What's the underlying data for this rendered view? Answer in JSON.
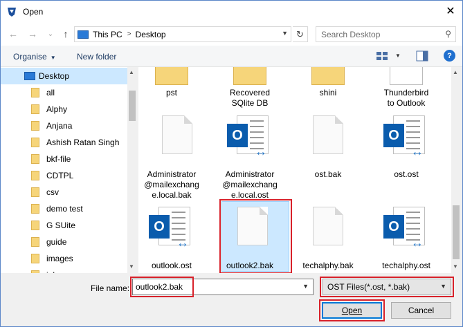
{
  "window": {
    "title": "Open",
    "close_glyph": "✕",
    "app_icon": "app-icon"
  },
  "nav": {
    "back": "←",
    "forward": "→",
    "recent": "⌄",
    "up": "↑",
    "breadcrumb": [
      "This PC",
      "Desktop"
    ],
    "search_placeholder": "Search Desktop"
  },
  "toolbar": {
    "organise": "Organise",
    "new_folder": "New folder",
    "help": "?"
  },
  "sidebar": {
    "items": [
      {
        "label": "Desktop",
        "selected": true,
        "icon": "desktop-icon"
      },
      {
        "label": "all"
      },
      {
        "label": "Alphy"
      },
      {
        "label": "Anjana"
      },
      {
        "label": "Ashish Ratan Singh"
      },
      {
        "label": "bkf-file"
      },
      {
        "label": "CDTPL"
      },
      {
        "label": "csv"
      },
      {
        "label": "demo test"
      },
      {
        "label": "G SUite"
      },
      {
        "label": "guide"
      },
      {
        "label": "images"
      },
      {
        "label": "jobs"
      }
    ]
  },
  "files": [
    {
      "lines": [
        "pst"
      ],
      "icon": "folder-icon"
    },
    {
      "lines": [
        "Recovered",
        "SQlite DB"
      ],
      "icon": "folder-icon"
    },
    {
      "lines": [
        "shini"
      ],
      "icon": "folder-icon"
    },
    {
      "lines": [
        "Thunderbird",
        "to Outlook"
      ],
      "icon": "folder-icon"
    },
    {
      "lines": [
        "Administrator",
        "@mailexchang",
        "e.local.bak"
      ],
      "icon": "document-icon"
    },
    {
      "lines": [
        "Administrator",
        "@mailexchang",
        "e.local.ost"
      ],
      "icon": "outlook-ost-icon"
    },
    {
      "lines": [
        "ost.bak"
      ],
      "icon": "document-icon"
    },
    {
      "lines": [
        "ost.ost"
      ],
      "icon": "outlook-ost-icon"
    },
    {
      "lines": [
        "outlook.ost"
      ],
      "icon": "outlook-ost-icon"
    },
    {
      "lines": [
        "outlook2.bak"
      ],
      "icon": "document-icon",
      "selected": true
    },
    {
      "lines": [
        "techalphy.bak"
      ],
      "icon": "document-icon"
    },
    {
      "lines": [
        "techalphy.ost"
      ],
      "icon": "outlook-ost-icon"
    }
  ],
  "bottom": {
    "file_name_label": "File name:",
    "file_name_value": "outlook2.bak",
    "filter": "OST Files(*.ost, *.bak)",
    "open": "Open",
    "cancel": "Cancel"
  },
  "colors": {
    "accent": "#0078d7",
    "highlight": "#d8212a",
    "selection": "#cce8ff"
  }
}
